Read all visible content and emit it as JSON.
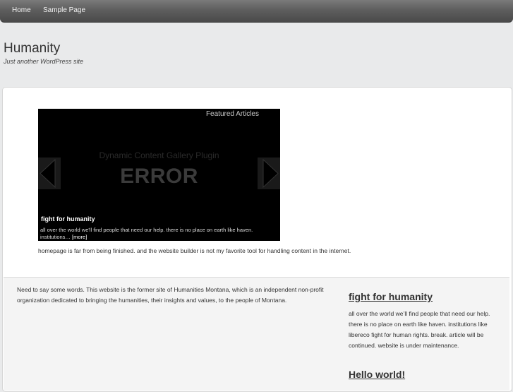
{
  "nav": {
    "items": [
      {
        "label": "Home"
      },
      {
        "label": "Sample Page"
      }
    ]
  },
  "site": {
    "title": "Humanity",
    "tagline": "Just another WordPress site"
  },
  "gallery": {
    "featured_label": "Featured Articles",
    "plugin_name": "Dynamic Content Gallery Plugin",
    "error_text": "ERROR",
    "slide_title": "fight for humanity",
    "slide_excerpt": "all over the world we'll find people that need our help. there is no place on earth like haven. institutions…",
    "slide_more": "[more]"
  },
  "homepage_note": "homepage is far from being finished. and the website builder is not my favorite tool for handling content in the internet.",
  "intro_text": "Need to say some words. This website is the former site of Humanities Montana, which is an independent non-profit organization dedicated to bringing the humanities, their insights and values, to the people of Montana.",
  "sidebar": {
    "posts": [
      {
        "title": "fight for humanity",
        "excerpt": "all over the world we’ll find people that need our help. there is no place on earth like haven. institutions like libereco fight for human rights. break. article will be continued. website is under maintenance."
      },
      {
        "title": "Hello world!"
      }
    ]
  },
  "colors": {
    "page_bg": "#e9eaeb",
    "nav_bg": "#5e5e5e",
    "gallery_bg": "#000000"
  }
}
